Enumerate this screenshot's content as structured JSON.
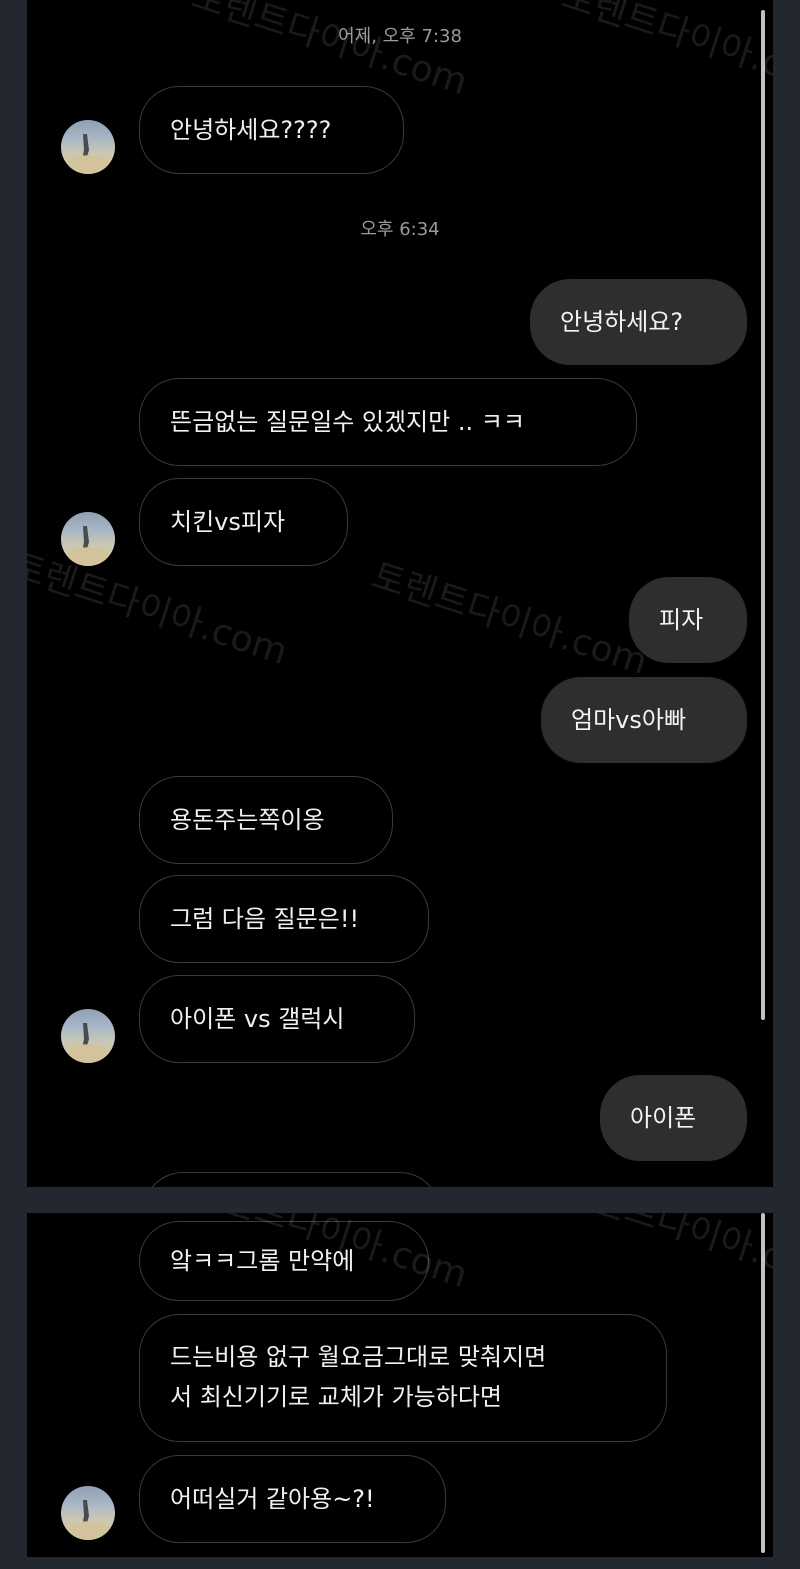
{
  "timestamps": [
    "어제, 오후 7:38",
    "오후 6:34"
  ],
  "messages": [
    {
      "side": "in",
      "text": "안녕하세요????"
    },
    {
      "side": "out",
      "text": "안녕하세요?"
    },
    {
      "side": "in",
      "text": "뜬금없는 질문일수 있겠지만 .. ㅋㅋ"
    },
    {
      "side": "in",
      "text": "치킨vs피자"
    },
    {
      "side": "out",
      "text": "피자"
    },
    {
      "side": "out",
      "text": "엄마vs아빠"
    },
    {
      "side": "in",
      "text": "용돈주는쪽이옹"
    },
    {
      "side": "in",
      "text": "그럼 다음 질문은!!"
    },
    {
      "side": "in",
      "text": "아이폰 vs 갤럭시"
    },
    {
      "side": "out",
      "text": "아이폰"
    },
    {
      "side": "in",
      "text": "앜ㅋㅋ그롬 만약에"
    },
    {
      "side": "in",
      "text": "드는비용 없구 월요금그대로 맞춰지면\n서 최신기기로 교체가 가능하다면"
    },
    {
      "side": "in",
      "text": "어떠실거 같아용~?!"
    }
  ],
  "watermark": "토렌트다이아.com",
  "colors": {
    "background": "#000000",
    "outer_background": "#23272f",
    "outgoing_bubble": "#2e2e2e",
    "incoming_border": "#3a3a3a",
    "timestamp_text": "#9a9a9a"
  },
  "icons": {
    "avatar": "profile-photo"
  }
}
